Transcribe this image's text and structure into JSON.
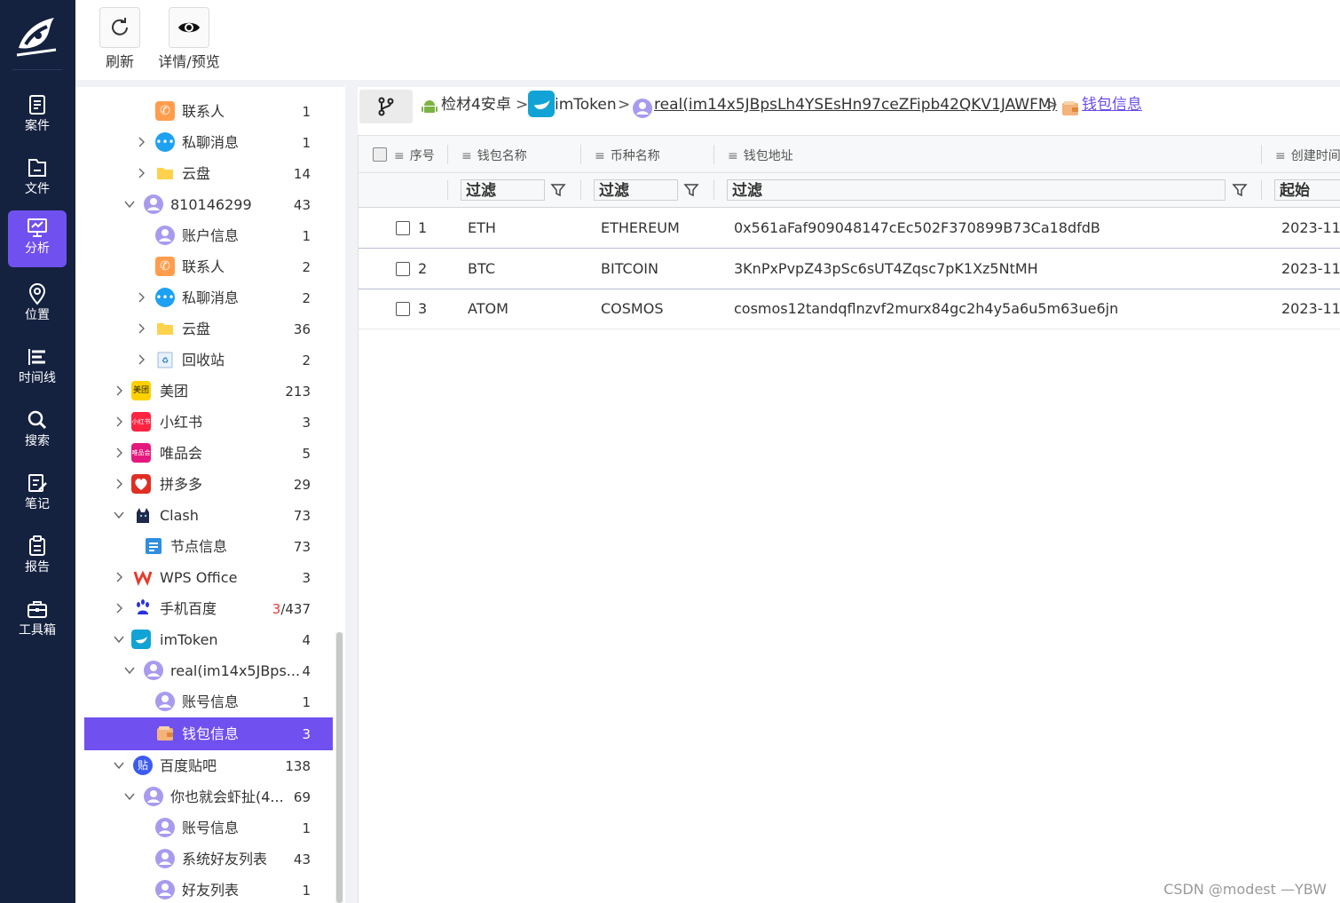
{
  "nav": {
    "items": [
      {
        "label": "案件",
        "icon": "case-icon"
      },
      {
        "label": "文件",
        "icon": "file-icon"
      },
      {
        "label": "分析",
        "icon": "analysis-icon"
      },
      {
        "label": "位置",
        "icon": "location-icon"
      },
      {
        "label": "时间线",
        "icon": "timeline-icon"
      },
      {
        "label": "搜索",
        "icon": "search-icon"
      },
      {
        "label": "笔记",
        "icon": "note-icon"
      },
      {
        "label": "报告",
        "icon": "report-icon"
      },
      {
        "label": "工具箱",
        "icon": "toolbox-icon"
      }
    ],
    "active": "分析"
  },
  "toolbar": {
    "refresh_label": "刷新",
    "preview_label": "详情/预览"
  },
  "tree": {
    "nodes": [
      {
        "name": "联系人",
        "count": "1"
      },
      {
        "name": "私聊消息",
        "count": "1"
      },
      {
        "name": "云盘",
        "count": "14"
      },
      {
        "name": "810146299",
        "count": "43"
      },
      {
        "name": "账户信息",
        "count": "1"
      },
      {
        "name": "联系人",
        "count": "2"
      },
      {
        "name": "私聊消息",
        "count": "2"
      },
      {
        "name": "云盘",
        "count": "36"
      },
      {
        "name": "回收站",
        "count": "2"
      },
      {
        "name": "美团",
        "count": "213",
        "icon_text": "美团"
      },
      {
        "name": "小红书",
        "count": "3",
        "icon_text": "小红书"
      },
      {
        "name": "唯品会",
        "count": "5",
        "icon_text": "唯品会"
      },
      {
        "name": "拼多多",
        "count": "29"
      },
      {
        "name": "Clash",
        "count": "73"
      },
      {
        "name": "节点信息",
        "count": "73"
      },
      {
        "name": "WPS Office",
        "count": "3"
      },
      {
        "name": "手机百度",
        "count_red": "3",
        "count_rest": "/437"
      },
      {
        "name": "imToken",
        "count": "4"
      },
      {
        "name": "real(im14x5JBps...",
        "count": "4"
      },
      {
        "name": "账号信息",
        "count": "1"
      },
      {
        "name": "钱包信息",
        "count": "3"
      },
      {
        "name": "百度贴吧",
        "count": "138",
        "icon_text": "贴"
      },
      {
        "name": "你也就会虾扯(4...",
        "count": "69"
      },
      {
        "name": "账号信息",
        "count": "1"
      },
      {
        "name": "系统好友列表",
        "count": "43"
      },
      {
        "name": "好友列表",
        "count": "1"
      }
    ]
  },
  "breadcrumb": {
    "items": [
      "检材4安卓",
      "imToken",
      "real(im14x5JBpsLh4YSEsHn97ceZFipb42QKV1JAWFM)",
      "钱包信息"
    ],
    "separator": ">"
  },
  "grid": {
    "headers": [
      "序号",
      "钱包名称",
      "币种名称",
      "钱包地址",
      "创建时间"
    ],
    "filter_placeholder": "过滤",
    "date_filter_placeholder": "起始",
    "rows": [
      {
        "index": "1",
        "wallet_name": "ETH",
        "coin_name": "ETHEREUM",
        "address": "0x561aFaf909048147cEc502F370899B73Ca18dfdB",
        "created": "2023-11-"
      },
      {
        "index": "2",
        "wallet_name": "BTC",
        "coin_name": "BITCOIN",
        "address": "3KnPxPvpZ43pSc6sUT4Zqsc7pK1Xz5NtMH",
        "created": "2023-11-"
      },
      {
        "index": "3",
        "wallet_name": "ATOM",
        "coin_name": "COSMOS",
        "address": "cosmos12tandqflnzvf2murx84gc2h4y5a6u5m63ue6jn",
        "created": "2023-11-"
      }
    ]
  },
  "watermark": "CSDN @modest —YBW",
  "colors": {
    "rail_bg": "#14213f",
    "accent": "#7150f0",
    "selected_text": "#ffffff",
    "count_alert": "#e53935"
  }
}
